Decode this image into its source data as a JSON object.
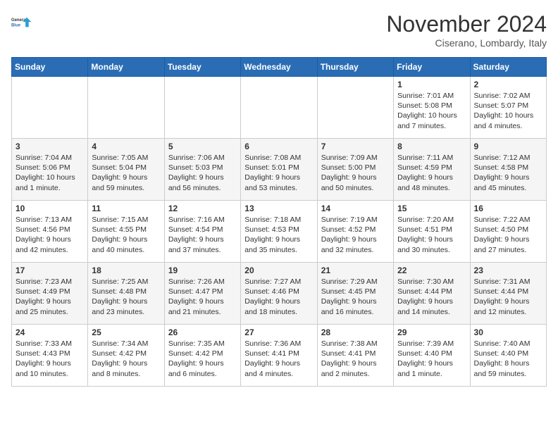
{
  "header": {
    "logo_line1": "General",
    "logo_line2": "Blue",
    "month": "November 2024",
    "location": "Ciserano, Lombardy, Italy"
  },
  "weekdays": [
    "Sunday",
    "Monday",
    "Tuesday",
    "Wednesday",
    "Thursday",
    "Friday",
    "Saturday"
  ],
  "weeks": [
    [
      {
        "day": "",
        "info": ""
      },
      {
        "day": "",
        "info": ""
      },
      {
        "day": "",
        "info": ""
      },
      {
        "day": "",
        "info": ""
      },
      {
        "day": "",
        "info": ""
      },
      {
        "day": "1",
        "info": "Sunrise: 7:01 AM\nSunset: 5:08 PM\nDaylight: 10 hours\nand 7 minutes."
      },
      {
        "day": "2",
        "info": "Sunrise: 7:02 AM\nSunset: 5:07 PM\nDaylight: 10 hours\nand 4 minutes."
      }
    ],
    [
      {
        "day": "3",
        "info": "Sunrise: 7:04 AM\nSunset: 5:06 PM\nDaylight: 10 hours\nand 1 minute."
      },
      {
        "day": "4",
        "info": "Sunrise: 7:05 AM\nSunset: 5:04 PM\nDaylight: 9 hours\nand 59 minutes."
      },
      {
        "day": "5",
        "info": "Sunrise: 7:06 AM\nSunset: 5:03 PM\nDaylight: 9 hours\nand 56 minutes."
      },
      {
        "day": "6",
        "info": "Sunrise: 7:08 AM\nSunset: 5:01 PM\nDaylight: 9 hours\nand 53 minutes."
      },
      {
        "day": "7",
        "info": "Sunrise: 7:09 AM\nSunset: 5:00 PM\nDaylight: 9 hours\nand 50 minutes."
      },
      {
        "day": "8",
        "info": "Sunrise: 7:11 AM\nSunset: 4:59 PM\nDaylight: 9 hours\nand 48 minutes."
      },
      {
        "day": "9",
        "info": "Sunrise: 7:12 AM\nSunset: 4:58 PM\nDaylight: 9 hours\nand 45 minutes."
      }
    ],
    [
      {
        "day": "10",
        "info": "Sunrise: 7:13 AM\nSunset: 4:56 PM\nDaylight: 9 hours\nand 42 minutes."
      },
      {
        "day": "11",
        "info": "Sunrise: 7:15 AM\nSunset: 4:55 PM\nDaylight: 9 hours\nand 40 minutes."
      },
      {
        "day": "12",
        "info": "Sunrise: 7:16 AM\nSunset: 4:54 PM\nDaylight: 9 hours\nand 37 minutes."
      },
      {
        "day": "13",
        "info": "Sunrise: 7:18 AM\nSunset: 4:53 PM\nDaylight: 9 hours\nand 35 minutes."
      },
      {
        "day": "14",
        "info": "Sunrise: 7:19 AM\nSunset: 4:52 PM\nDaylight: 9 hours\nand 32 minutes."
      },
      {
        "day": "15",
        "info": "Sunrise: 7:20 AM\nSunset: 4:51 PM\nDaylight: 9 hours\nand 30 minutes."
      },
      {
        "day": "16",
        "info": "Sunrise: 7:22 AM\nSunset: 4:50 PM\nDaylight: 9 hours\nand 27 minutes."
      }
    ],
    [
      {
        "day": "17",
        "info": "Sunrise: 7:23 AM\nSunset: 4:49 PM\nDaylight: 9 hours\nand 25 minutes."
      },
      {
        "day": "18",
        "info": "Sunrise: 7:25 AM\nSunset: 4:48 PM\nDaylight: 9 hours\nand 23 minutes."
      },
      {
        "day": "19",
        "info": "Sunrise: 7:26 AM\nSunset: 4:47 PM\nDaylight: 9 hours\nand 21 minutes."
      },
      {
        "day": "20",
        "info": "Sunrise: 7:27 AM\nSunset: 4:46 PM\nDaylight: 9 hours\nand 18 minutes."
      },
      {
        "day": "21",
        "info": "Sunrise: 7:29 AM\nSunset: 4:45 PM\nDaylight: 9 hours\nand 16 minutes."
      },
      {
        "day": "22",
        "info": "Sunrise: 7:30 AM\nSunset: 4:44 PM\nDaylight: 9 hours\nand 14 minutes."
      },
      {
        "day": "23",
        "info": "Sunrise: 7:31 AM\nSunset: 4:44 PM\nDaylight: 9 hours\nand 12 minutes."
      }
    ],
    [
      {
        "day": "24",
        "info": "Sunrise: 7:33 AM\nSunset: 4:43 PM\nDaylight: 9 hours\nand 10 minutes."
      },
      {
        "day": "25",
        "info": "Sunrise: 7:34 AM\nSunset: 4:42 PM\nDaylight: 9 hours\nand 8 minutes."
      },
      {
        "day": "26",
        "info": "Sunrise: 7:35 AM\nSunset: 4:42 PM\nDaylight: 9 hours\nand 6 minutes."
      },
      {
        "day": "27",
        "info": "Sunrise: 7:36 AM\nSunset: 4:41 PM\nDaylight: 9 hours\nand 4 minutes."
      },
      {
        "day": "28",
        "info": "Sunrise: 7:38 AM\nSunset: 4:41 PM\nDaylight: 9 hours\nand 2 minutes."
      },
      {
        "day": "29",
        "info": "Sunrise: 7:39 AM\nSunset: 4:40 PM\nDaylight: 9 hours\nand 1 minute."
      },
      {
        "day": "30",
        "info": "Sunrise: 7:40 AM\nSunset: 4:40 PM\nDaylight: 8 hours\nand 59 minutes."
      }
    ]
  ]
}
